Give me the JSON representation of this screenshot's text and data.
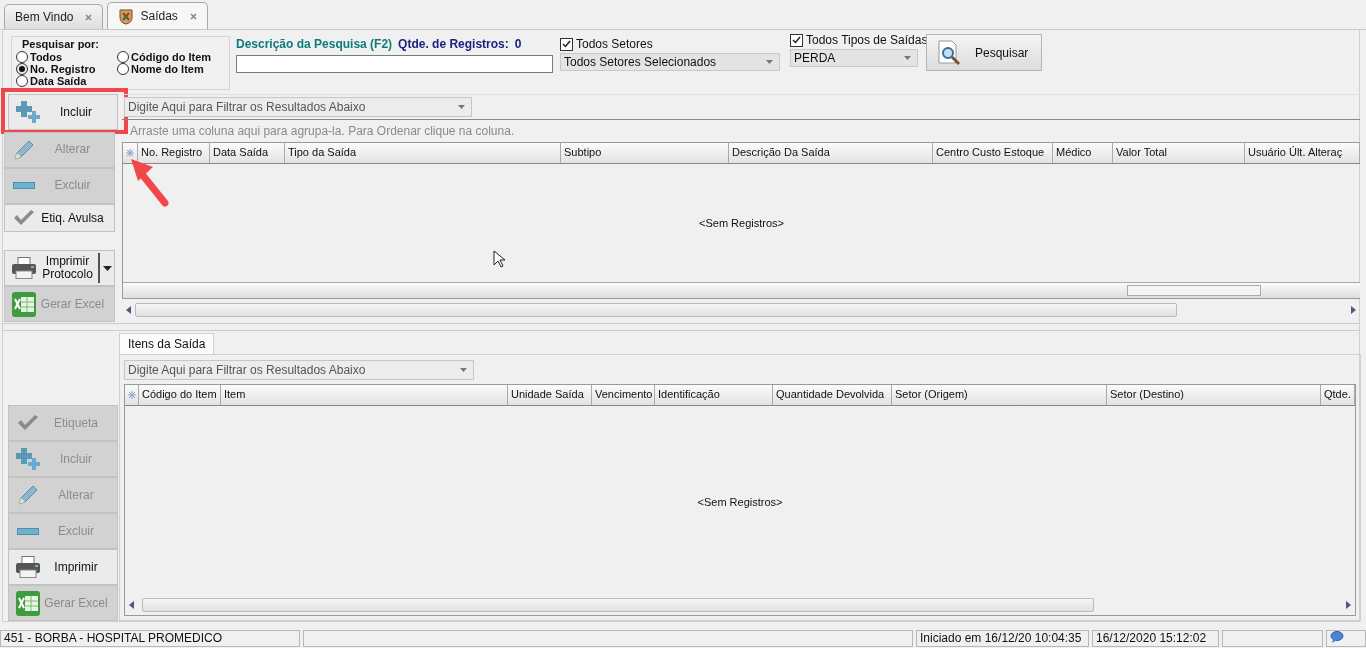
{
  "tabs": [
    {
      "label": "Bem Vindo",
      "selected": false
    },
    {
      "label": "Saídas",
      "selected": true
    }
  ],
  "search_by": {
    "label": "Pesquisar por:",
    "options": [
      {
        "label": "Todos",
        "selected": false
      },
      {
        "label": "No. Registro",
        "selected": true
      },
      {
        "label": "Data Saída",
        "selected": false
      },
      {
        "label": "Código do Item",
        "selected": false
      },
      {
        "label": "Nome do Item",
        "selected": false
      }
    ]
  },
  "search_description": {
    "label": "Descrição da Pesquisa (F2)"
  },
  "record_count": {
    "label": "Qtde. de Registros:",
    "value": "0"
  },
  "sector_filter": {
    "label": "Todos Setores",
    "checked": true,
    "value": "Todos Setores Selecionados"
  },
  "exit_type_filter": {
    "label": "Todos Tipos de Saídas",
    "checked": true,
    "value": "PERDA"
  },
  "search_button": "Pesquisar",
  "actions": [
    {
      "label": "Incluir",
      "kind": "add",
      "disabled": false,
      "highlighted": true
    },
    {
      "label": "Alterar",
      "kind": "edit",
      "disabled": true,
      "highlighted": false
    },
    {
      "label": "Excluir",
      "kind": "delete",
      "disabled": true,
      "highlighted": false
    },
    {
      "label": "Etiq. Avulsa",
      "kind": "label",
      "disabled": false,
      "highlighted": false
    },
    {
      "label": "Imprimir Protocolo",
      "kind": "print",
      "disabled": false,
      "highlighted": false,
      "dropdown": true
    },
    {
      "label": "Gerar Excel",
      "kind": "export",
      "disabled": true,
      "highlighted": false
    }
  ],
  "exits_grid": {
    "filter": {
      "placeholder": "Digite Aqui para Filtrar os Resultados Abaixo"
    },
    "group_hint": "Arraste uma coluna aqui para agrupa-la. Para Ordenar clique na coluna.",
    "columns": [
      "No. Registro",
      "Data Saída",
      "Tipo da Saída",
      "Subtipo",
      "Descrição Da Saída",
      "Centro Custo Estoque",
      "Médico",
      "Valor Total",
      "Usuário Últ. Alteraç"
    ],
    "empty_text": "<Sem Registros>"
  },
  "items_tab": {
    "label": "Itens da Saída",
    "selected": true
  },
  "item_actions": [
    {
      "label": "Etiqueta",
      "kind": "label",
      "disabled": true
    },
    {
      "label": "Incluir",
      "kind": "add",
      "disabled": true
    },
    {
      "label": "Alterar",
      "kind": "edit",
      "disabled": true
    },
    {
      "label": "Excluir",
      "kind": "delete",
      "disabled": true
    },
    {
      "label": "Imprimir",
      "kind": "print",
      "disabled": false
    },
    {
      "label": "Gerar Excel",
      "kind": "export",
      "disabled": true
    }
  ],
  "items_grid": {
    "filter": {
      "placeholder": "Digite Aqui para Filtrar os Resultados Abaixo"
    },
    "columns": [
      "Código do Item",
      "Item",
      "Unidade Saída",
      "Vencimento",
      "Identificação",
      "Quantidade Devolvida",
      "Setor (Origem)",
      "Setor (Destino)",
      "Qtde."
    ],
    "empty_text": "<Sem Registros>"
  },
  "status_bar": [
    {
      "kind": "text",
      "text": "451 - BORBA - HOSPITAL PROMEDICO"
    },
    {
      "kind": "blank"
    },
    {
      "kind": "text",
      "text": "Iniciado em 16/12/20 10:04:35"
    },
    {
      "kind": "text",
      "text": "16/12/2020 15:12:02"
    },
    {
      "kind": "blank"
    },
    {
      "kind": "icon"
    }
  ]
}
